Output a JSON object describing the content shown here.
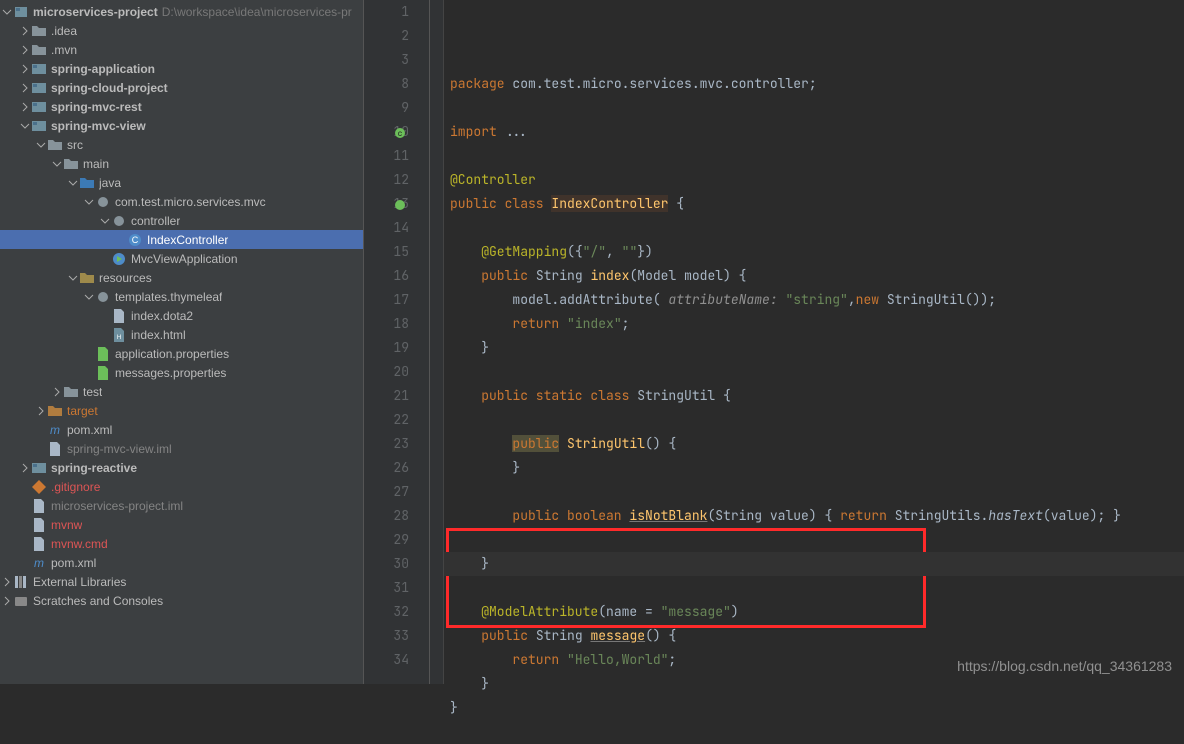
{
  "tree": {
    "root": {
      "label": "microservices-project",
      "hint": "D:\\workspace\\idea\\microservices-pr"
    },
    "items": [
      {
        "depth": 1,
        "arrow": "r",
        "icon": "folder",
        "label": ".idea"
      },
      {
        "depth": 1,
        "arrow": "r",
        "icon": "folder",
        "label": ".mvn"
      },
      {
        "depth": 1,
        "arrow": "r",
        "icon": "module",
        "label": "spring-application",
        "bold": true
      },
      {
        "depth": 1,
        "arrow": "r",
        "icon": "module",
        "label": "spring-cloud-project",
        "bold": true
      },
      {
        "depth": 1,
        "arrow": "r",
        "icon": "module",
        "label": "spring-mvc-rest",
        "bold": true
      },
      {
        "depth": 1,
        "arrow": "d",
        "icon": "module",
        "label": "spring-mvc-view",
        "bold": true
      },
      {
        "depth": 2,
        "arrow": "d",
        "icon": "folder",
        "label": "src"
      },
      {
        "depth": 3,
        "arrow": "d",
        "icon": "folder",
        "label": "main"
      },
      {
        "depth": 4,
        "arrow": "d",
        "icon": "folder-src",
        "label": "java"
      },
      {
        "depth": 5,
        "arrow": "d",
        "icon": "package",
        "label": "com.test.micro.services.mvc"
      },
      {
        "depth": 6,
        "arrow": "d",
        "icon": "package",
        "label": "controller"
      },
      {
        "depth": 7,
        "arrow": "",
        "icon": "class",
        "label": "IndexController",
        "selected": true
      },
      {
        "depth": 6,
        "arrow": "",
        "icon": "class-run",
        "label": "MvcViewApplication"
      },
      {
        "depth": 4,
        "arrow": "d",
        "icon": "folder-res",
        "label": "resources"
      },
      {
        "depth": 5,
        "arrow": "d",
        "icon": "package",
        "label": "templates.thymeleaf"
      },
      {
        "depth": 6,
        "arrow": "",
        "icon": "file",
        "label": "index.dota2"
      },
      {
        "depth": 6,
        "arrow": "",
        "icon": "html",
        "label": "index.html"
      },
      {
        "depth": 5,
        "arrow": "",
        "icon": "props",
        "label": "application.properties"
      },
      {
        "depth": 5,
        "arrow": "",
        "icon": "props",
        "label": "messages.properties"
      },
      {
        "depth": 3,
        "arrow": "r",
        "icon": "folder",
        "label": "test"
      },
      {
        "depth": 2,
        "arrow": "r",
        "icon": "folder-target",
        "label": "target",
        "orange": true
      },
      {
        "depth": 2,
        "arrow": "",
        "icon": "maven",
        "label": "pom.xml"
      },
      {
        "depth": 2,
        "arrow": "",
        "icon": "file",
        "label": "spring-mvc-view.iml",
        "dim": true
      },
      {
        "depth": 1,
        "arrow": "r",
        "icon": "module",
        "label": "spring-reactive",
        "bold": true
      },
      {
        "depth": 1,
        "arrow": "",
        "icon": "git",
        "label": ".gitignore",
        "red": true
      },
      {
        "depth": 1,
        "arrow": "",
        "icon": "file",
        "label": "microservices-project.iml",
        "dim": true
      },
      {
        "depth": 1,
        "arrow": "",
        "icon": "file",
        "label": "mvnw",
        "red": true
      },
      {
        "depth": 1,
        "arrow": "",
        "icon": "file",
        "label": "mvnw.cmd",
        "red": true
      },
      {
        "depth": 1,
        "arrow": "",
        "icon": "maven",
        "label": "pom.xml"
      }
    ],
    "extLib": "External Libraries",
    "scratches": "Scratches and Consoles"
  },
  "editor": {
    "lines": [
      {
        "n": 1,
        "html": "<span class='kw'>package</span> <span class='txt'>com.test.micro.services.mvc.controller;</span>"
      },
      {
        "n": 2,
        "html": ""
      },
      {
        "n": 3,
        "html": "<span class='kw'>import</span> <span class='txt'>...</span>"
      },
      {
        "n": 8,
        "html": ""
      },
      {
        "n": 9,
        "html": "<span class='ann'>@Controller</span>"
      },
      {
        "n": 10,
        "html": "<span class='kw'>public class</span> <span class='hl-class'>IndexController</span> <span class='pun'>{</span>",
        "mark": "c"
      },
      {
        "n": 11,
        "html": ""
      },
      {
        "n": 12,
        "html": "    <span class='ann'>@GetMapping</span><span class='pun'>({</span><span class='str'>\"/\"</span><span class='pun'>, </span><span class='str'>\"\"</span><span class='pun'>})</span>"
      },
      {
        "n": 13,
        "html": "    <span class='kw'>public</span> <span class='txt'>String</span> <span class='def'>index</span><span class='pun'>(Model model) {</span>",
        "mark": "g"
      },
      {
        "n": 14,
        "html": "        <span class='txt'>model.addAttribute(</span> <span class='param'>attributeName:</span> <span class='str'>\"string\"</span><span class='pun'>,</span><span class='kw'>new</span> <span class='txt'>StringUtil());</span>"
      },
      {
        "n": 15,
        "html": "        <span class='kw'>return </span><span class='str'>\"index\"</span><span class='pun'>;</span>"
      },
      {
        "n": 16,
        "html": "    <span class='pun'>}</span>"
      },
      {
        "n": 17,
        "html": ""
      },
      {
        "n": 18,
        "html": "    <span class='kw'>public static class</span> <span class='txt'>StringUtil {</span>"
      },
      {
        "n": 19,
        "html": ""
      },
      {
        "n": 20,
        "html": "        <span class='hl-public'>public</span> <span class='def'>StringUtil</span><span class='pun'>() {</span>"
      },
      {
        "n": 21,
        "html": "        <span class='pun'>}</span>"
      },
      {
        "n": 22,
        "html": ""
      },
      {
        "n": 23,
        "html": "        <span class='kw'>public boolean</span> <span class='def under'>isNotBlank</span><span class='pun'>(String value)</span> <span class='pun'>{</span> <span class='kw'>return</span> <span class='txt'>StringUtils.</span><span class='ital'>hasText</span><span class='pun'>(value);</span> <span class='pun'>}</span>"
      },
      {
        "n": 26,
        "html": ""
      },
      {
        "n": 27,
        "html": "    <span class='pun'>}</span>"
      },
      {
        "n": 28,
        "html": ""
      },
      {
        "n": 29,
        "html": "    <span class='ann'>@ModelAttribute</span><span class='pun'>(name = </span><span class='str'>\"message\"</span><span class='pun'>)</span>"
      },
      {
        "n": 30,
        "html": "    <span class='kw'>public</span> <span class='txt'>String</span> <span class='def under'>message</span><span class='pun'>() {</span>",
        "cur": true
      },
      {
        "n": 31,
        "html": "        <span class='kw'>return </span><span class='str'>\"Hello,World\"</span><span class='pun'>;</span>"
      },
      {
        "n": 32,
        "html": "    <span class='pun'>}</span>"
      },
      {
        "n": 33,
        "html": "<span class='pun'>}</span>"
      },
      {
        "n": 34,
        "html": ""
      }
    ]
  },
  "watermark": "https://blog.csdn.net/qq_34361283"
}
